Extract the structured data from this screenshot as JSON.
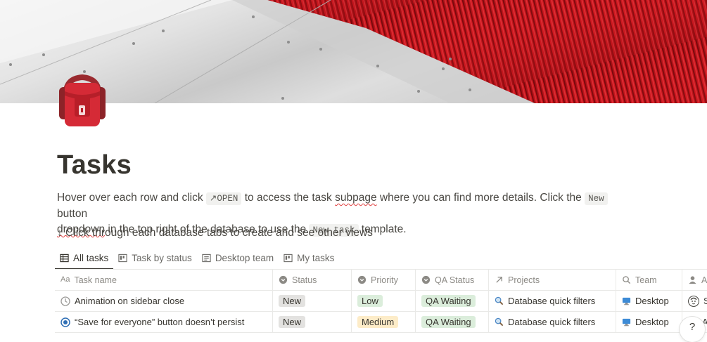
{
  "page": {
    "title": "Tasks",
    "description": {
      "t1": "Hover over each row and click ",
      "open_badge": "↗OPEN",
      "t2": " to access the task ",
      "subpage": "subpage",
      "t3": " where you can find more details. Click the ",
      "new_badge": "New",
      "t4": " button ",
      "dropdown": "dropdown",
      "t5": " in the top right of the database to use the ",
      "newtask_badge": "New task",
      "t6": " template."
    },
    "hint": "↓ Click through each database tabs to create and see other views"
  },
  "tabs": [
    {
      "label": "All tasks",
      "icon": "table-icon",
      "active": true
    },
    {
      "label": "Task by status",
      "icon": "board-icon"
    },
    {
      "label": "Desktop team",
      "icon": "list-icon"
    },
    {
      "label": "My tasks",
      "icon": "board-icon"
    }
  ],
  "columns": [
    "Task name",
    "Status",
    "Priority",
    "QA Status",
    "Projects",
    "Team",
    "As"
  ],
  "rows": [
    {
      "task": "Animation on sidebar close",
      "status": "New",
      "priority": "Low",
      "qa": "QA Waiting",
      "project": "Database quick filters",
      "team": "Desktop",
      "assignee": "S"
    },
    {
      "task": "“Save for everyone” button doesn’t persist",
      "status": "New",
      "priority": "Medium",
      "qa": "QA Waiting",
      "project": "Database quick filters",
      "team": "Desktop",
      "assignee": "A"
    }
  ],
  "colors": {
    "status_new_bg": "#e3e2e0",
    "priority_low_bg": "#dbeddb",
    "priority_medium_bg": "#fdecc8",
    "qa_waiting_bg": "#dbeddb",
    "cover_red": "#c8161d"
  },
  "help": {
    "label": "?"
  }
}
